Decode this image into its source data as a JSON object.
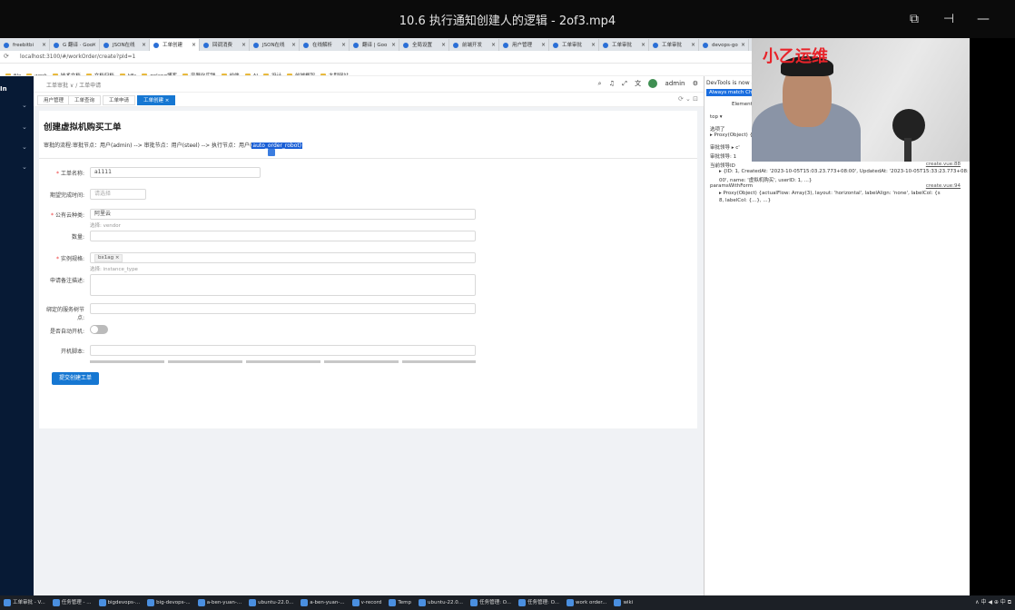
{
  "player": {
    "title": "10.6 执行通知创建人的逻辑 - 2of3.mp4",
    "icons": [
      "picture-in-picture-icon",
      "pin-icon",
      "minimize-icon"
    ]
  },
  "browser": {
    "tabs": [
      {
        "label": "freebitbi",
        "active": false
      },
      {
        "label": "G 翻译 · Goo",
        "active": false
      },
      {
        "label": "JSON在线",
        "active": false
      },
      {
        "label": "工单创建",
        "active": true
      },
      {
        "label": "回调消费",
        "active": false
      },
      {
        "label": "JSON在线",
        "active": false
      },
      {
        "label": "在线解析",
        "active": false
      },
      {
        "label": "翻译 | Goo",
        "active": false
      },
      {
        "label": "全局设置",
        "active": false
      },
      {
        "label": "前端开发",
        "active": false
      },
      {
        "label": "用户管理",
        "active": false
      },
      {
        "label": "工单审批",
        "active": false
      },
      {
        "label": "工单审批",
        "active": false
      },
      {
        "label": "工单审批",
        "active": false
      },
      {
        "label": "devops-go",
        "active": false
      }
    ],
    "url": "localhost:3100/#/workOrder/create?pId=1",
    "bookmarks": [
      "file",
      "work",
      "技术文档",
      "文档归档",
      "k8s",
      "golang博客",
      "容器化实践",
      "前端",
      "AI",
      "设计",
      "前端框架",
      "大型网站"
    ]
  },
  "sidebar": {
    "logo": "In",
    "arrows": [
      "⌄",
      "⌄",
      "⌄",
      "⌄"
    ]
  },
  "app": {
    "breadcrumb": "工单审批 ∨ / 工单申请",
    "header_icons": {
      "user": "admin"
    },
    "tabs": [
      {
        "label": "用户管理",
        "active": false
      },
      {
        "label": "工单查询",
        "active": false
      },
      {
        "label": "工单申请",
        "active": false
      },
      {
        "label": "工单创建 ×",
        "active": true
      }
    ],
    "page_title": "创建虚拟机购买工单",
    "flow_text": "审批的流程:审批节点：用户(admin) --> 审批节点：用户(steel) --> 执行节点：用户(",
    "flow_highlight": "auto_order_robot)",
    "form": {
      "name_label": "工单名称:",
      "name_value": "a1111",
      "expected_label": "期望完成时间:",
      "expected_placeholder": "请选择",
      "provider_label": "公有云种类:",
      "provider_value": "阿里云",
      "provider_hint": "选择: vendor",
      "count_label": "数量:",
      "spec_label": "实例规格:",
      "spec_tag": "bx1ag ×",
      "spec_hint": "选择: instance_type",
      "desc_label": "申请备注描述:",
      "bind_label": "绑定的服务树节点:",
      "autostart_label": "是否自动开机:",
      "script_label": "开机脚本:",
      "submit": "提交创建工单"
    }
  },
  "devtools": {
    "top": "DevTools is now available in Chinese",
    "badge": "Always match Chrome",
    "tab": "Elements",
    "filter": "top ▾",
    "lines": [
      {
        "text": "选项了",
        "link": ""
      },
      {
        "text": "▸ Proxy(Object) {...}",
        "link": ""
      },
      {
        "text": "审批领导 ▸ c'",
        "link": ""
      },
      {
        "text": "审批领导: 1",
        "link": ""
      },
      {
        "text": "当前领导ID",
        "link": "create.vue:88"
      }
    ],
    "objects": [
      "▸ {ID: 1, CreatedAt: '2023-10-05T15:03.23.773+08:00', UpdatedAt: '2023-10-05T15:33:23.773+08:",
      "00', name: '虚拟机购买', userID: 1, ...}"
    ],
    "line2": {
      "text": "paramsWithForm",
      "link": "create.vue:94"
    },
    "objects2": [
      "▸ Proxy(Object) {actualFlow: Array(3), layout: 'horizontal', labelAlign: 'none', labelCol: {s",
      "8, labelCol: {...}, ...}"
    ]
  },
  "webcam": {
    "watermark": "小乙运维"
  },
  "taskbar": {
    "items": [
      "工单审批 - V...",
      "任务管理 - ...",
      "bigdevops-...",
      "big-devops-...",
      "a-ben-yuan-...",
      "ubuntu-22.0...",
      "a-ben-yuan-...",
      "v-record",
      "Temp",
      "ubuntu-22.0...",
      "任务管理: O...",
      "任务管理: O...",
      "work order...",
      "wiki"
    ],
    "tray": "∧ 中 ◀ ⊕ 中 ⧉"
  }
}
